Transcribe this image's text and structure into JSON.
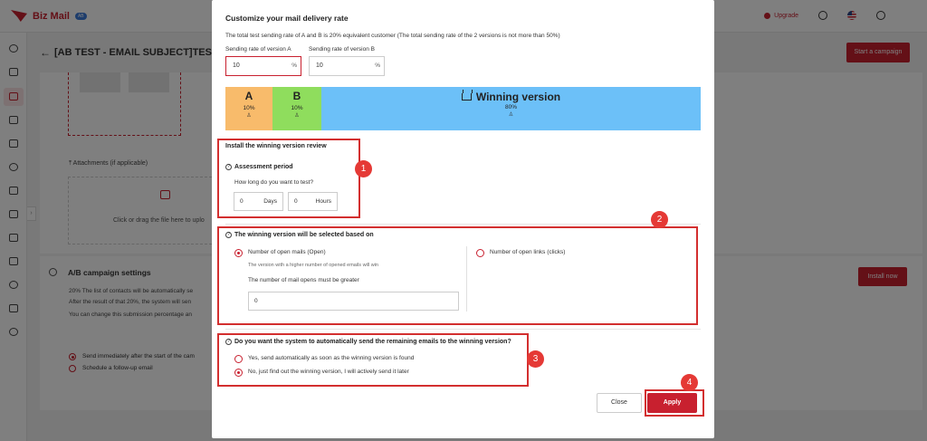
{
  "app": {
    "logo_text": "Biz Mail",
    "logo_badge": "AB",
    "upgrade_label": "Upgrade",
    "page_title": "[AB TEST - EMAIL SUBJECT]TEST",
    "start_campaign_label": "Start a campaign",
    "attachments_label": "Attachments (if applicable)",
    "upload_text": "Click or drag the file here to uplo",
    "ab_settings_title": "A/B campaign settings",
    "ab_text_1": "20% The list of contacts will be automatically se",
    "ab_text_2": "After the result of that 20%, the system will sen",
    "ab_text_3": "You can change this submission percentage an",
    "install_now_label": "Install now",
    "send_option_1": "Send immediately after the start of the cam",
    "send_option_2": "Schedule a follow-up email",
    "accent_color": "#c8202f"
  },
  "modal": {
    "title": "Customize your mail delivery rate",
    "description": "The total test sending rate of A and B is 20% equivalent customer (The total sending rate of the 2 versions is not more than 50%)",
    "rate_a_label": "Sending rate of version A",
    "rate_a_value": "10",
    "rate_b_label": "Sending rate of version B",
    "rate_b_value": "10",
    "percent_symbol": "%",
    "bar": {
      "a_label": "A",
      "a_pct": "10%",
      "b_label": "B",
      "b_pct": "10%",
      "winning_label": "Winning version",
      "winning_pct": "80%",
      "a_color": "#f8bb6b",
      "b_color": "#8fdd5d",
      "winning_color": "#6cc0f8"
    },
    "review": {
      "title": "Install the winning version review",
      "period_label": "Assessment period",
      "question": "How long do you want to test?",
      "days_value": "0",
      "days_unit": "Days",
      "hours_value": "0",
      "hours_unit": "Hours"
    },
    "basis": {
      "title": "The winning version will be selected based on",
      "option_open": "Number of open mails (Open)",
      "option_open_hint": "The version with a higher number of opened emails will win",
      "opens_label": "The number of mail opens must be greater",
      "opens_value": "0",
      "option_clicks": "Number of open links (clicks)",
      "selected": "open"
    },
    "auto_send": {
      "title": "Do you want the system to automatically send the remaining emails to the winning version?",
      "option_yes": "Yes, send automatically as soon as the winning version is found",
      "option_no": "No, just find out the winning version, I will actively send it later",
      "selected": "no"
    },
    "close_label": "Close",
    "apply_label": "Apply"
  },
  "annotations": {
    "n1": "1",
    "n2": "2",
    "n3": "3",
    "n4": "4",
    "color": "#d32f2f"
  }
}
